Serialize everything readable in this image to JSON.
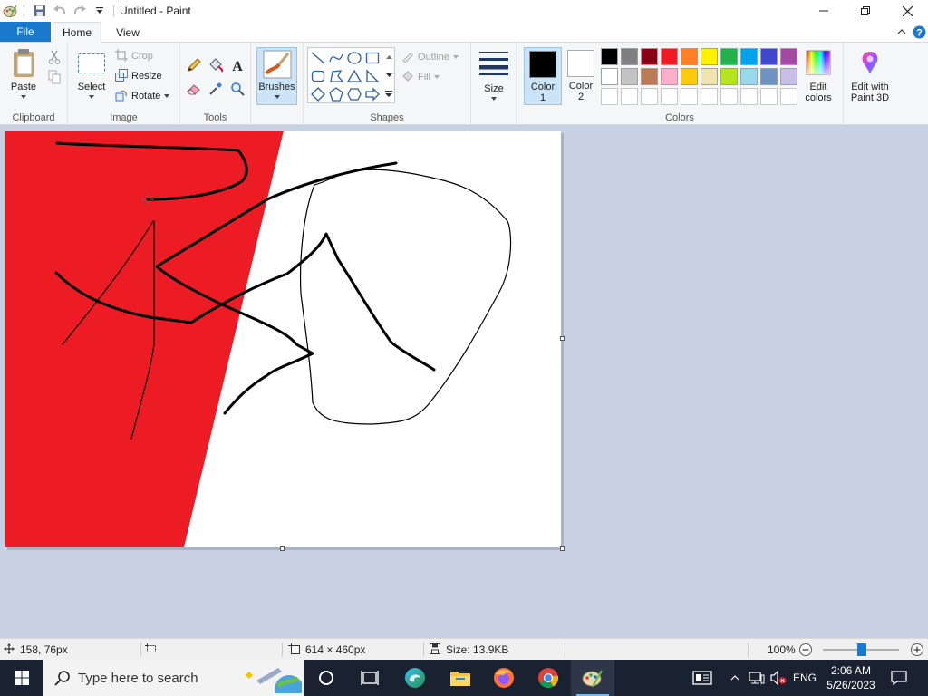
{
  "window": {
    "title": "Untitled - Paint",
    "icons": [
      "paint-app-icon",
      "save-icon",
      "undo-icon",
      "redo-icon",
      "customize-quick-access-icon"
    ]
  },
  "tabs": {
    "file": "File",
    "home": "Home",
    "view": "View",
    "active": "Home"
  },
  "ribbon": {
    "clipboard": {
      "label": "Clipboard",
      "paste": "Paste"
    },
    "image": {
      "label": "Image",
      "select": "Select",
      "crop": "Crop",
      "resize": "Resize",
      "rotate": "Rotate"
    },
    "tools": {
      "label": "Tools",
      "items": [
        "pencil-icon",
        "fill-icon",
        "text-icon",
        "eraser-icon",
        "color-picker-icon",
        "magnifier-icon"
      ]
    },
    "brushes": "Brushes",
    "shapes": {
      "label": "Shapes",
      "outline": "Outline",
      "fill": "Fill"
    },
    "size": "Size",
    "colors": {
      "label": "Colors",
      "color1_line1": "Color",
      "color1_line2": "1",
      "color2_line1": "Color",
      "color2_line2": "2",
      "color1_value": "#000000",
      "color2_value": "#ffffff",
      "edit_line1": "Edit",
      "edit_line2": "colors",
      "paint3d_line1": "Edit with",
      "paint3d_line2": "Paint 3D",
      "palette_row1": [
        "#000000",
        "#7f7f7f",
        "#880015",
        "#ed1c24",
        "#ff7f27",
        "#fff200",
        "#22b14c",
        "#00a2e8",
        "#3f48cc",
        "#a349a4"
      ],
      "palette_row2": [
        "#ffffff",
        "#c3c3c3",
        "#b97a57",
        "#ffaec9",
        "#ffc90e",
        "#efe4b0",
        "#b5e61d",
        "#99d9ea",
        "#7092be",
        "#c8bfe7"
      ],
      "palette_row3_count": 10
    }
  },
  "canvas": {
    "red_fill": "#ed1c24",
    "stroke": "#000000"
  },
  "status": {
    "cursor_pos": "158, 76px",
    "canvas_size": "614 × 460px",
    "file_size": "Size: 13.9KB",
    "zoom": "100%"
  },
  "taskbar": {
    "search_placeholder": "Type here to search",
    "language": "ENG",
    "time": "2:06 AM",
    "date": "5/26/2023"
  }
}
